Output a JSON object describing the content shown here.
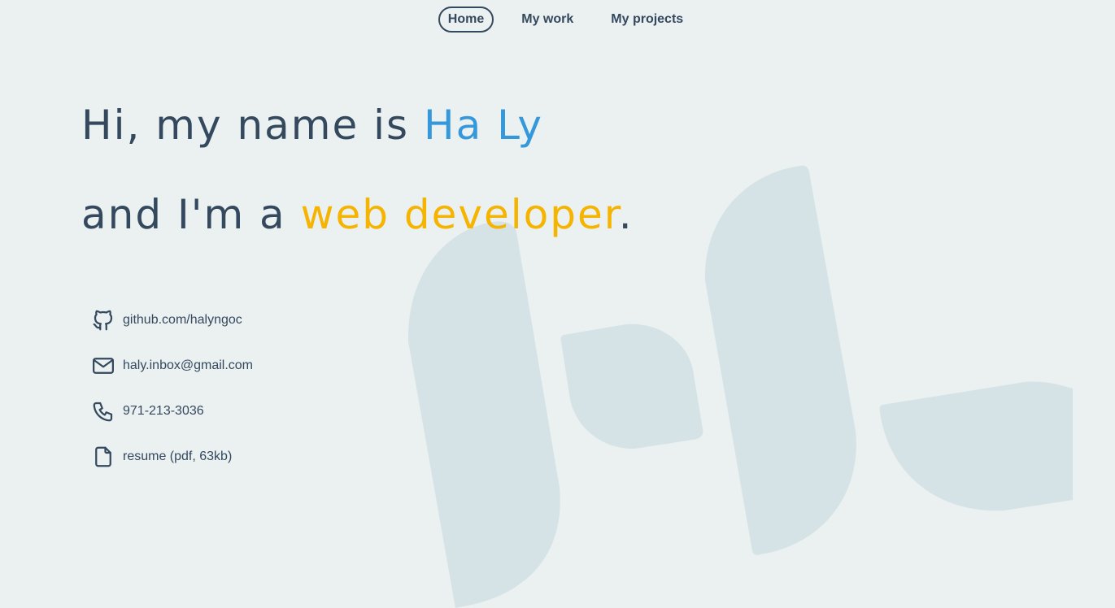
{
  "nav": {
    "items": [
      {
        "label": "Home",
        "active": true
      },
      {
        "label": "My work",
        "active": false
      },
      {
        "label": "My projects",
        "active": false
      }
    ]
  },
  "hero": {
    "line1_prefix": "Hi, my name is ",
    "line1_name": "Ha Ly",
    "line2_prefix": "and I'm a ",
    "line2_role": "web developer",
    "line2_suffix": "."
  },
  "contacts": [
    {
      "icon": "github-icon",
      "label": "github.com/halyngoc"
    },
    {
      "icon": "mail-icon",
      "label": "haly.inbox@gmail.com"
    },
    {
      "icon": "phone-icon",
      "label": "971-213-3036"
    },
    {
      "icon": "file-icon",
      "label": "resume (pdf, 63kb)"
    }
  ],
  "colors": {
    "background": "#ebf0f1",
    "text": "#34495e",
    "accent_blue": "#3498db",
    "accent_yellow": "#f5b400",
    "logo_shape": "#d5e3e6"
  }
}
